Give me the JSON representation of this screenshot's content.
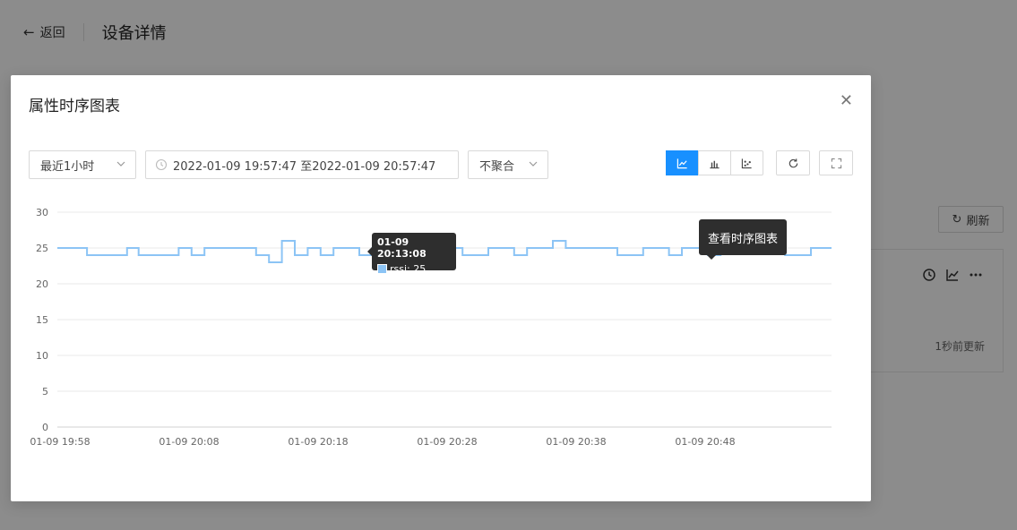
{
  "background": {
    "back_label": "返回",
    "page_title": "设备详情",
    "refresh_label": "刷新",
    "updated_label": "1秒前更新"
  },
  "modal": {
    "title": "属性时序图表",
    "range_select": "最近1小时",
    "time_range": "2022-01-09 19:57:47 至2022-01-09 20:57:47",
    "aggregate_select": "不聚合",
    "hint_label": "查看时序图表"
  },
  "tooltip": {
    "time": "01-09 20:13:08",
    "value_label": "rssi: 25"
  },
  "colors": {
    "accent": "#1890ff",
    "series": "#8cc4f5"
  },
  "chart_data": {
    "type": "line",
    "ylim": [
      0,
      30
    ],
    "yticks": [
      0,
      5,
      10,
      15,
      20,
      25,
      30
    ],
    "xticks": [
      "01-09 19:58",
      "01-09 20:08",
      "01-09 20:18",
      "01-09 20:28",
      "01-09 20:38",
      "01-09 20:48"
    ],
    "xtick_minutes": [
      0,
      10,
      20,
      30,
      40,
      50
    ],
    "xlim_minutes": [
      0,
      60
    ],
    "grid": true,
    "series": [
      {
        "name": "rssi",
        "points": [
          [
            0,
            25
          ],
          [
            2.3,
            25
          ],
          [
            2.3,
            24
          ],
          [
            5.4,
            24
          ],
          [
            5.4,
            25
          ],
          [
            6.3,
            25
          ],
          [
            6.3,
            24
          ],
          [
            9.4,
            24
          ],
          [
            9.4,
            25
          ],
          [
            10.4,
            25
          ],
          [
            10.4,
            24
          ],
          [
            11.4,
            24
          ],
          [
            11.4,
            25
          ],
          [
            15.4,
            25
          ],
          [
            15.4,
            24
          ],
          [
            16.4,
            24
          ],
          [
            16.4,
            23
          ],
          [
            17.4,
            23
          ],
          [
            17.4,
            26
          ],
          [
            18.4,
            26
          ],
          [
            18.4,
            24
          ],
          [
            19.4,
            24
          ],
          [
            19.4,
            25
          ],
          [
            20.4,
            25
          ],
          [
            20.4,
            24
          ],
          [
            21.4,
            24
          ],
          [
            21.4,
            25
          ],
          [
            23.4,
            25
          ],
          [
            23.4,
            24
          ],
          [
            24.4,
            24
          ],
          [
            24.4,
            25
          ],
          [
            25.4,
            25
          ],
          [
            25.4,
            24
          ],
          [
            26.4,
            24
          ],
          [
            26.4,
            25
          ],
          [
            28.7,
            25
          ],
          [
            28.7,
            24
          ],
          [
            29.5,
            24
          ],
          [
            29.5,
            25
          ],
          [
            31.4,
            25
          ],
          [
            31.4,
            24
          ],
          [
            33.4,
            24
          ],
          [
            33.4,
            25
          ],
          [
            35.4,
            25
          ],
          [
            35.4,
            24
          ],
          [
            36.4,
            24
          ],
          [
            36.4,
            25
          ],
          [
            38.4,
            25
          ],
          [
            38.4,
            26
          ],
          [
            39.4,
            26
          ],
          [
            39.4,
            25
          ],
          [
            43.4,
            25
          ],
          [
            43.4,
            24
          ],
          [
            45.4,
            24
          ],
          [
            45.4,
            25
          ],
          [
            47.4,
            25
          ],
          [
            47.4,
            24
          ],
          [
            48.4,
            24
          ],
          [
            48.4,
            25
          ],
          [
            50.4,
            25
          ],
          [
            50.4,
            24
          ],
          [
            51.4,
            24
          ],
          [
            51.4,
            25
          ],
          [
            56.4,
            25
          ],
          [
            56.4,
            24
          ],
          [
            58.4,
            24
          ],
          [
            58.4,
            25
          ],
          [
            60,
            25
          ]
        ]
      }
    ]
  }
}
